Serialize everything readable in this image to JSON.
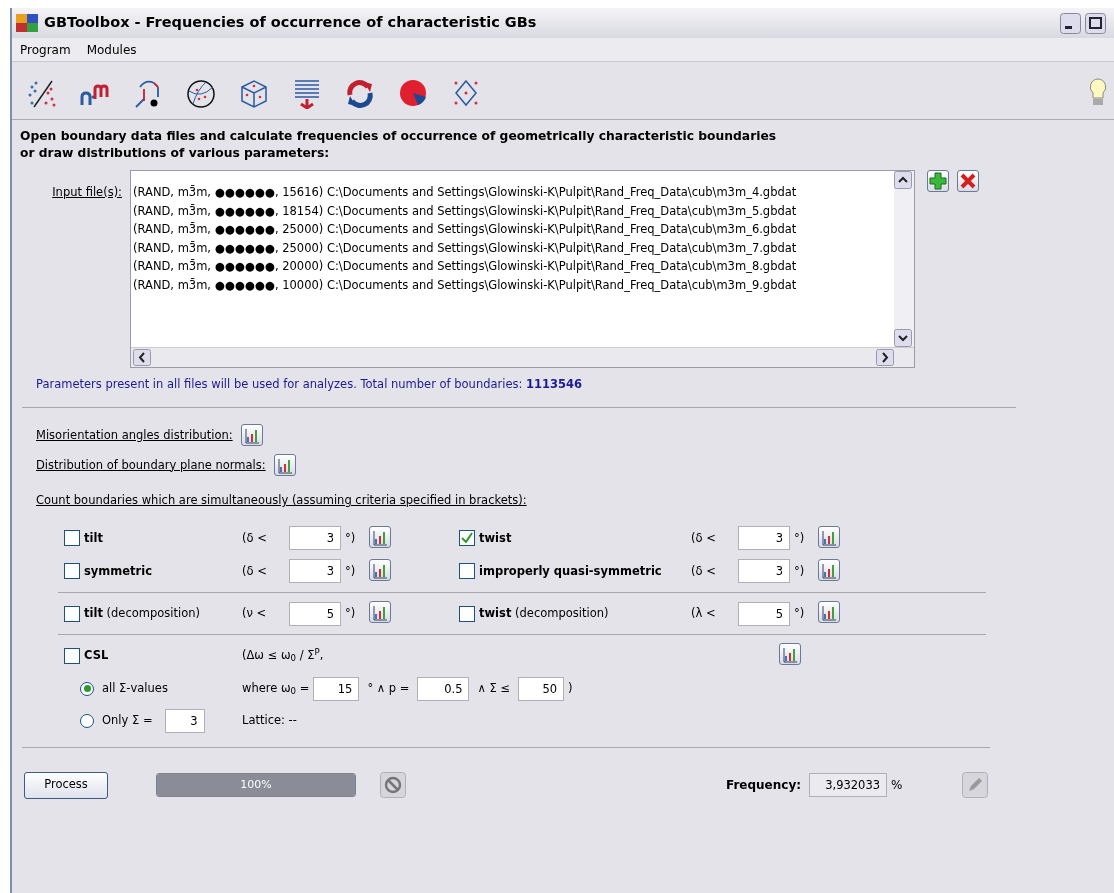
{
  "window": {
    "title": "GBToolbox - Frequencies of occurrence of characteristic GBs"
  },
  "menu": [
    "Program",
    "Modules"
  ],
  "intro": "Open boundary data files and calculate frequencies of occurrence of geometrically characteristic boundaries\nor draw distributions of various parameters:",
  "input_files": {
    "label": "Input file(s):",
    "files": [
      "(RAND, m3̄m, ●●●●●●, 15616) C:\\Documents and Settings\\Glowinski-K\\Pulpit\\Rand_Freq_Data\\cub\\m3m_4.gbdat",
      "(RAND, m3̄m, ●●●●●●, 18154) C:\\Documents and Settings\\Glowinski-K\\Pulpit\\Rand_Freq_Data\\cub\\m3m_5.gbdat",
      "(RAND, m3̄m, ●●●●●●, 25000) C:\\Documents and Settings\\Glowinski-K\\Pulpit\\Rand_Freq_Data\\cub\\m3m_6.gbdat",
      "(RAND, m3̄m, ●●●●●●, 25000) C:\\Documents and Settings\\Glowinski-K\\Pulpit\\Rand_Freq_Data\\cub\\m3m_7.gbdat",
      "(RAND, m3̄m, ●●●●●●, 20000) C:\\Documents and Settings\\Glowinski-K\\Pulpit\\Rand_Freq_Data\\cub\\m3m_8.gbdat",
      "(RAND, m3̄m, ●●●●●●, 10000) C:\\Documents and Settings\\Glowinski-K\\Pulpit\\Rand_Freq_Data\\cub\\m3m_9.gbdat"
    ]
  },
  "summary": "Parameters present in all files will be used for analyzes. Total number of boundaries: **1113546**",
  "distributions": [
    "Misorientation angles distribution:",
    "Distribution of boundary plane normals:"
  ],
  "count_label": "Count boundaries which are simultaneously (assuming criteria specified in brackets):",
  "criteria_groups": [
    [
      {
        "label": "tilt",
        "checked": false,
        "open": "(δ <",
        "value": "3",
        "close": "°)"
      },
      {
        "label": "twist",
        "checked": true,
        "open": "(δ <",
        "value": "3",
        "close": "°)"
      },
      {
        "label": "symmetric",
        "checked": false,
        "open": "(δ <",
        "value": "3",
        "close": "°)"
      },
      {
        "label": "improperly quasi-symmetric",
        "checked": false,
        "open": "(δ <",
        "value": "3",
        "close": "°)"
      }
    ],
    [
      {
        "label": "tilt",
        "suffix": "(decomposition)",
        "checked": false,
        "open": "(ν <",
        "value": "5",
        "close": "°)"
      },
      {
        "label": "twist",
        "suffix": "(decomposition)",
        "checked": false,
        "open": "(λ <",
        "value": "5",
        "close": "°)"
      }
    ]
  ],
  "csl": {
    "label": "CSL",
    "checked": false,
    "formula": "(Δω ≤ ω$_{0}$ / Σ$^{P}$,",
    "options": [
      {
        "label": "all Σ-values",
        "selected": true
      },
      {
        "label": "Only Σ =",
        "selected": false,
        "value": "3"
      }
    ],
    "where": "where ω$_{0}$ =",
    "omega": "15",
    "p_label": "° ∧ p =",
    "p": "0.5",
    "sigma_label": "∧ Σ ≤",
    "sigma": "50",
    "end": ")",
    "lattice": "Lattice: --"
  },
  "footer": {
    "process": "Process",
    "progress": {
      "level": 1,
      "text": "100%"
    },
    "frequency_label": "Frequency:",
    "frequency": "3,932033",
    "unit": "%"
  }
}
